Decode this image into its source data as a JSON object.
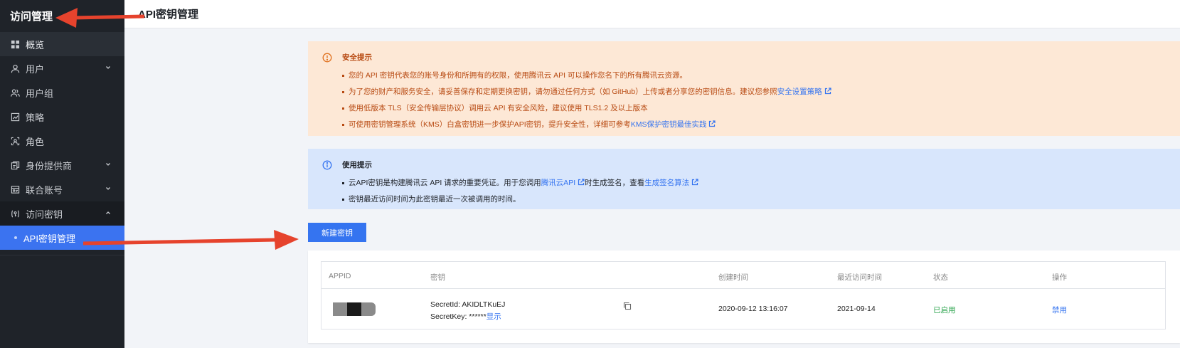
{
  "sidebar": {
    "title": "访问管理",
    "items": [
      {
        "label": "概览",
        "icon": "grid-icon"
      },
      {
        "label": "用户",
        "icon": "user-icon"
      },
      {
        "label": "用户组",
        "icon": "user-group-icon"
      },
      {
        "label": "策略",
        "icon": "policy-icon"
      },
      {
        "label": "角色",
        "icon": "role-icon"
      },
      {
        "label": "身份提供商",
        "icon": "identity-provider-icon"
      },
      {
        "label": "联合账号",
        "icon": "federated-account-icon"
      },
      {
        "label": "访问密钥",
        "icon": "access-key-icon"
      },
      {
        "label": "API密钥管理",
        "icon": "dot-icon"
      }
    ]
  },
  "header": {
    "title": "API密钥管理"
  },
  "security_alert": {
    "title": "安全提示",
    "line1": "您的 API 密钥代表您的账号身份和所拥有的权限，使用腾讯云 API 可以操作您名下的所有腾讯云资源。",
    "line2_text": "为了您的财产和服务安全，请妥善保存和定期更换密钥，请勿通过任何方式（如 GitHub）上传或者分享您的密钥信息。建议您参照",
    "line2_link": "安全设置策略",
    "line3": "使用低版本 TLS（安全传输层协议）调用云 API 有安全风险，建议使用 TLS1.2 及以上版本",
    "line4_text": "可使用密钥管理系统（KMS）白盒密钥进一步保护API密钥，提升安全性，详细可参考",
    "line4_link": "KMS保护密钥最佳实践"
  },
  "usage_alert": {
    "title": "使用提示",
    "line1_a": "云API密钥是构建腾讯云 API 请求的重要凭证。用于您调用",
    "line1_link1": "腾讯云API",
    "line1_b": "时生成签名，查看",
    "line1_link2": "生成签名算法",
    "line2": "密钥最近访问时间为此密钥最近一次被调用的时间。"
  },
  "new_key_button": "新建密钥",
  "table": {
    "columns": [
      "APPID",
      "密钥",
      "创建时间",
      "最近访问时间",
      "状态",
      "操作"
    ],
    "rows": [
      {
        "secret_id": "SecretId: AKIDLTKuEJ",
        "secret_key_label": "SecretKey: ******",
        "show_link": "显示",
        "created": "2020-09-12 13:16:07",
        "last_access": "2021-09-14",
        "status": "已启用",
        "action": "禁用"
      }
    ]
  },
  "colors": {
    "sidebar_bg": "#1f2329",
    "accent": "#3574f0",
    "warn_bg": "#fde8d6",
    "info_bg": "#d8e6fc",
    "arrow": "#e6432d",
    "status_green": "#2da44e"
  }
}
